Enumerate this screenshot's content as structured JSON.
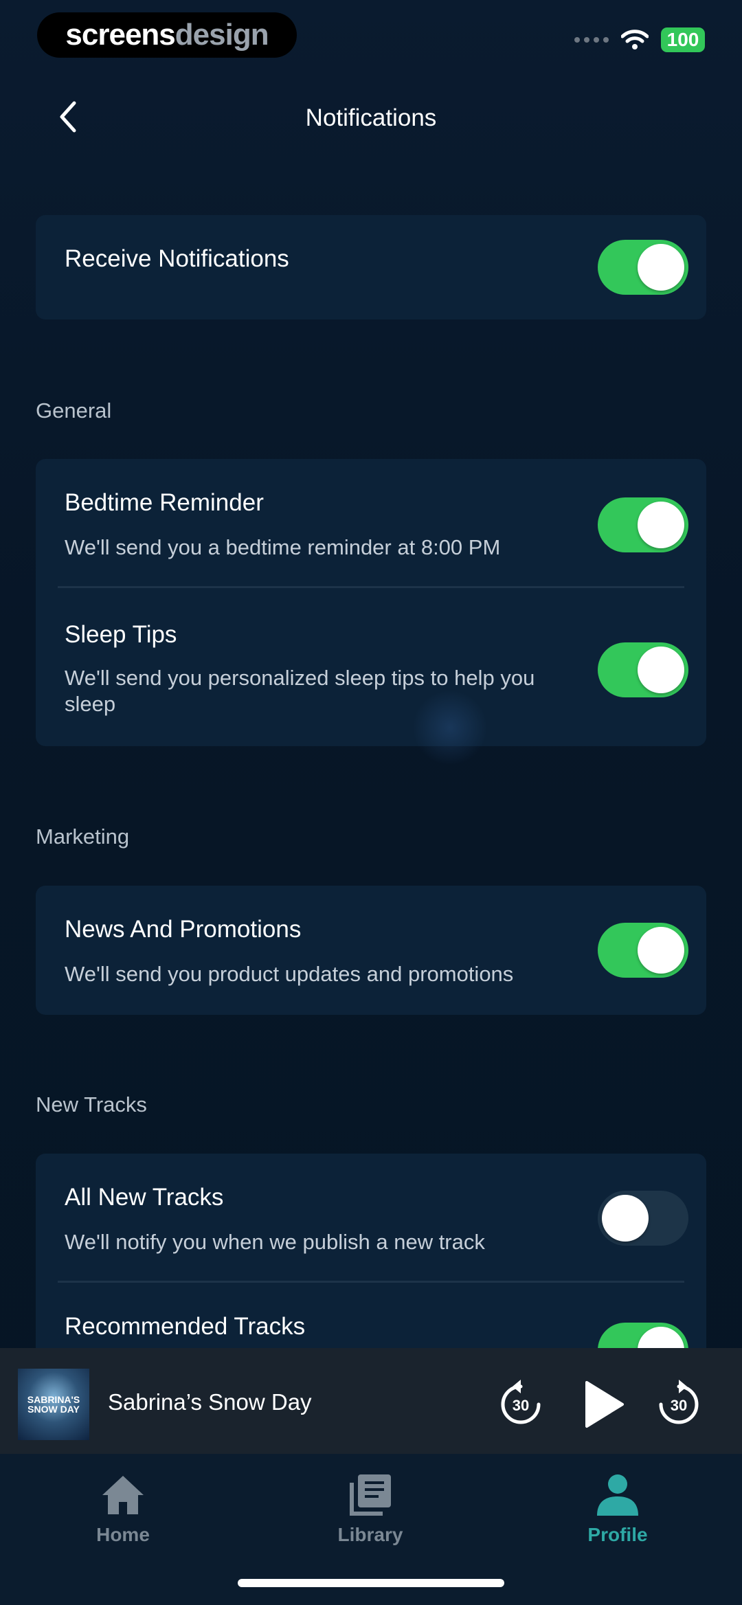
{
  "status_bar": {
    "brand_part1": "screens",
    "brand_part2": "design",
    "battery": "100"
  },
  "header": {
    "title": "Notifications"
  },
  "master": {
    "label": "Receive Notifications",
    "enabled": true
  },
  "sections": {
    "general": {
      "label": "General",
      "items": [
        {
          "title": "Bedtime Reminder",
          "desc": "We'll send you a bedtime reminder at 8:00 PM",
          "enabled": true
        },
        {
          "title": "Sleep Tips",
          "desc": "We'll send you personalized sleep tips to help you sleep",
          "enabled": true
        }
      ]
    },
    "marketing": {
      "label": "Marketing",
      "items": [
        {
          "title": "News And Promotions",
          "desc": "We'll send you product updates and promotions",
          "enabled": true
        }
      ]
    },
    "new_tracks": {
      "label": "New Tracks",
      "items": [
        {
          "title": "All New Tracks",
          "desc": "We'll notify you when we publish a new track",
          "enabled": false
        },
        {
          "title": "Recommended Tracks",
          "enabled": true
        }
      ]
    }
  },
  "player": {
    "album_art_text": "SABRINA'S SNOW DAY",
    "track_title": "Sabrina’s Snow Day",
    "skip_back_seconds": "30",
    "skip_forward_seconds": "30"
  },
  "tabs": [
    {
      "label": "Home",
      "icon": "home-icon",
      "active": false
    },
    {
      "label": "Library",
      "icon": "library-icon",
      "active": false
    },
    {
      "label": "Profile",
      "icon": "profile-icon",
      "active": true
    }
  ],
  "colors": {
    "background": "#071627",
    "card": "#0c2238",
    "toggle_on": "#33c75a",
    "toggle_off": "#1d3448",
    "active_tab": "#2ea9a5"
  }
}
